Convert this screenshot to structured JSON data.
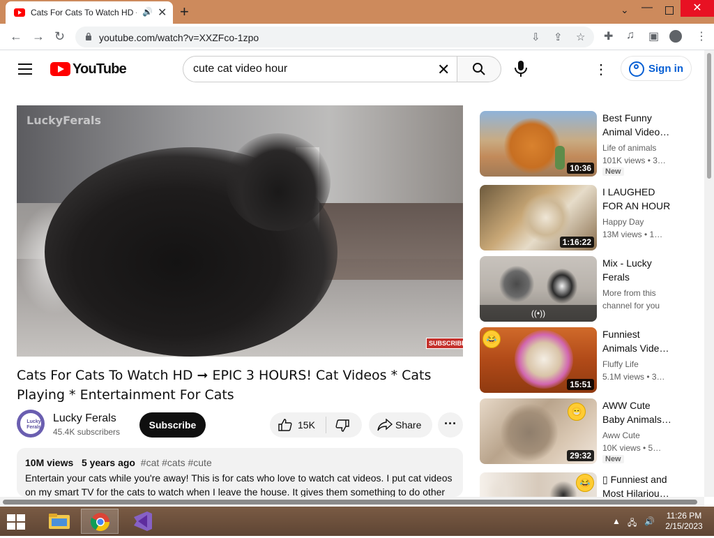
{
  "browser": {
    "tab_title": "Cats For Cats To Watch HD ➞",
    "url": "youtube.com/watch?v=XXZFco-1zpo"
  },
  "youtube": {
    "logo_text": "YouTube",
    "search_value": "cute cat video hour",
    "signin_label": "Sign in"
  },
  "video": {
    "watermark": "LuckyFerals",
    "player_subscribe": "SUBSCRIBE",
    "title": "Cats For Cats To Watch HD ➞ EPIC 3 HOURS! Cat Videos * Cats Playing * Entertainment For Cats",
    "channel_name": "Lucky Ferals",
    "channel_avatar_text": "Lucky Ferals",
    "subscribers": "45.4K subscribers",
    "subscribe_label": "Subscribe",
    "likes": "15K",
    "share_label": "Share",
    "views": "10M views",
    "age": "5 years ago",
    "tags": "#cat #cats #cute",
    "description": "Entertain your cats while you're away! This is for cats who love to watch cat videos. I put cat videos on my smart TV for the cats to watch when I leave the house. It gives them something to do other"
  },
  "recommendations": [
    {
      "title": "Best Funny Animal Video…",
      "channel": "Life of animals",
      "meta": "101K views • 3…",
      "duration": "10:36",
      "badge": "New"
    },
    {
      "title": "I LAUGHED FOR AN HOUR😹…",
      "channel": "Happy Day",
      "meta": "13M views • 1…",
      "duration": "1:16:22",
      "badge": ""
    },
    {
      "title": "Mix - Lucky Ferals",
      "channel": "More from this",
      "meta": "channel for you",
      "duration": "",
      "badge": "",
      "live_icon": "((•))"
    },
    {
      "title": "Funniest Animals Vide…",
      "channel": "Fluffy Life",
      "meta": "5.1M views • 3…",
      "duration": "15:51",
      "badge": ""
    },
    {
      "title": "AWW Cute Baby Animals…",
      "channel": "Aww Cute",
      "meta": "10K views • 5…",
      "duration": "29:32",
      "badge": "New"
    },
    {
      "title": "▯ Funniest and Most Hilariou…",
      "channel": "",
      "meta": "",
      "duration": "",
      "badge": ""
    }
  ],
  "taskbar": {
    "time": "11:26 PM",
    "date": "2/15/2023"
  },
  "colors": {
    "accent_red": "#ff0000",
    "link_blue": "#065fd4",
    "tabstrip": "#cd8a5c",
    "taskbar": "#6b4e3a"
  }
}
